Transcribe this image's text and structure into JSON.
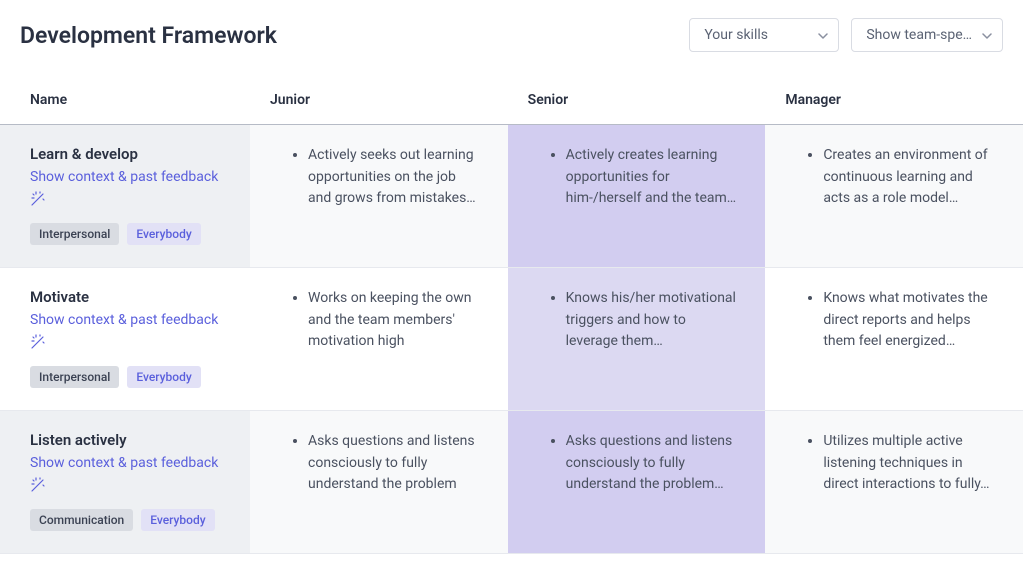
{
  "header": {
    "title": "Development Framework",
    "dropdown1": "Your skills",
    "dropdown2": "Show team-spe…"
  },
  "columns": {
    "name": "Name",
    "junior": "Junior",
    "senior": "Senior",
    "manager": "Manager"
  },
  "feedback_link_label": "Show context & past feedback",
  "skills": [
    {
      "name": "Learn & develop",
      "cat_tag": "Interpersonal",
      "aud_tag": "Everybody",
      "junior": "Actively seeks out learning opportunities on the job and grows from mistakes…",
      "senior": "Actively creates learning opportunities for him-/herself and the team…",
      "manager": "Creates an environment of continuous learning and acts as a role model…"
    },
    {
      "name": "Motivate",
      "cat_tag": "Interpersonal",
      "aud_tag": "Everybody",
      "junior": "Works on keeping the own and the team members' motivation high",
      "senior": "Knows his/her motivational triggers and how to leverage them…",
      "manager": "Knows what motivates the direct reports and helps them feel energized…"
    },
    {
      "name": "Listen actively",
      "cat_tag": "Communication",
      "aud_tag": "Everybody",
      "junior": "Asks questions and listens consciously to fully understand the problem",
      "senior": "Asks questions and listens consciously to fully understand the problem…",
      "manager": "Utilizes multiple active listening techniques in direct interactions to fully…"
    }
  ]
}
